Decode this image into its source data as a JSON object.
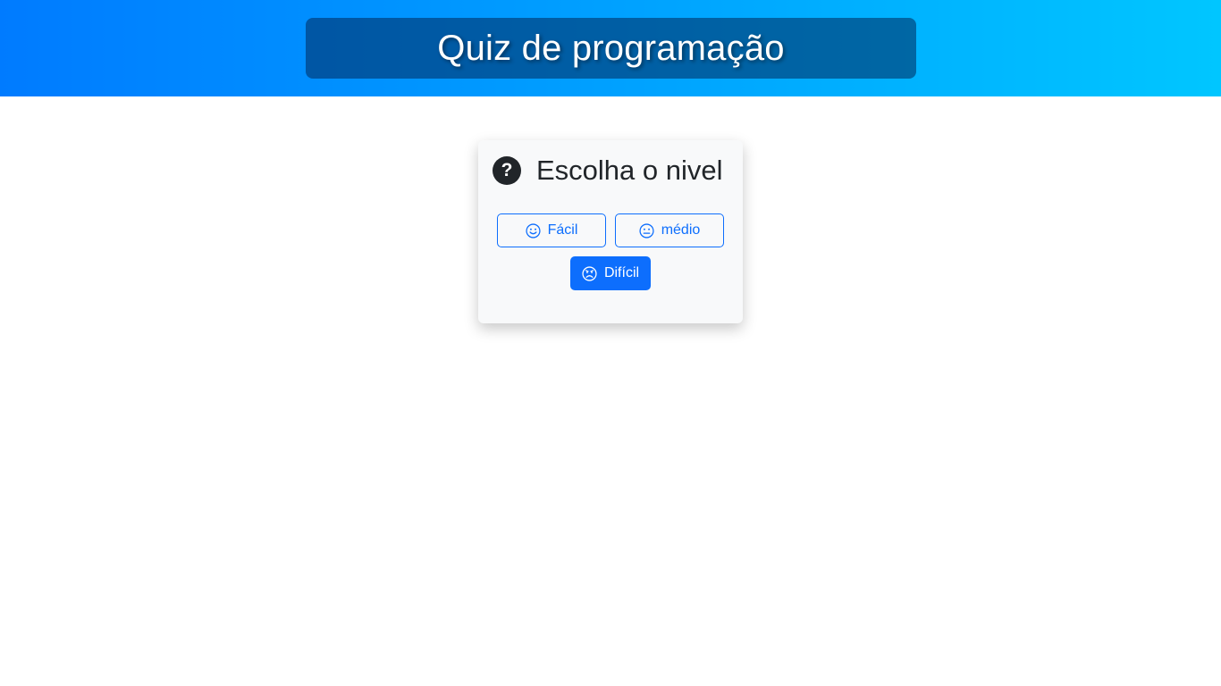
{
  "header": {
    "title": "Quiz de programação",
    "gradient_start": "#007bff",
    "gradient_end": "#00c6ff"
  },
  "card": {
    "icon": "question-circle-icon",
    "title": "Escolha o nivel",
    "buttons": [
      {
        "label": "Fácil",
        "icon": "smile-icon",
        "style": "outline"
      },
      {
        "label": "médio",
        "icon": "neutral-face-icon",
        "style": "outline"
      },
      {
        "label": "Difícil",
        "icon": "frown-icon",
        "style": "solid",
        "color": "#0d6efd"
      }
    ]
  }
}
